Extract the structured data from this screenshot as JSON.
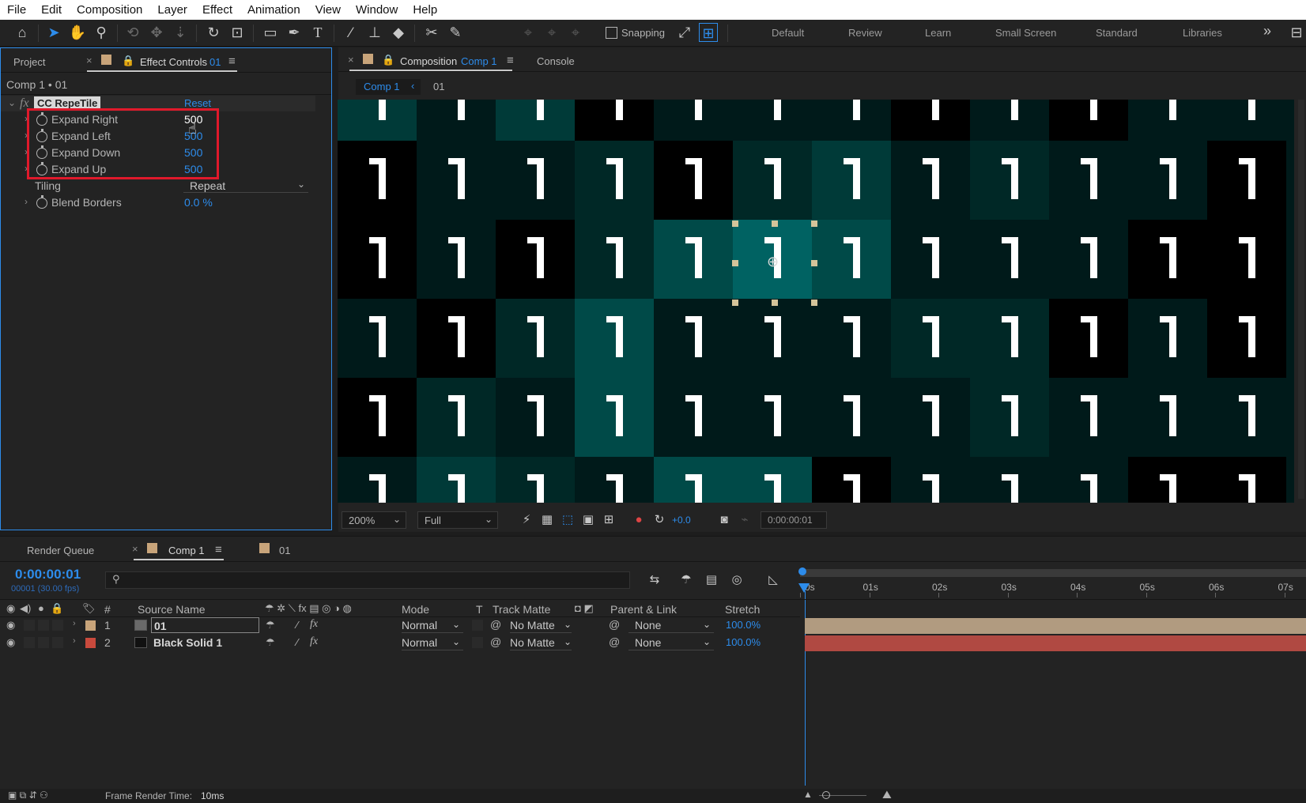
{
  "menu": [
    "File",
    "Edit",
    "Composition",
    "Layer",
    "Effect",
    "Animation",
    "View",
    "Window",
    "Help"
  ],
  "toolbar": {
    "snapping_label": "Snapping",
    "workspaces": [
      "Default",
      "Review",
      "Learn",
      "Small Screen",
      "Standard",
      "Libraries"
    ],
    "more": "»"
  },
  "left_panel": {
    "tab_project": "Project",
    "tab_effect_controls": "Effect Controls",
    "tab_effect_target": "01",
    "breadcrumb": "Comp 1 • 01",
    "effect_name": "CC RepeTile",
    "reset_label": "Reset",
    "fx_label": "fx",
    "properties": [
      {
        "label": "Expand Right",
        "value": "500"
      },
      {
        "label": "Expand Left",
        "value": "500"
      },
      {
        "label": "Expand Down",
        "value": "500"
      },
      {
        "label": "Expand Up",
        "value": "500"
      }
    ],
    "tiling_label": "Tiling",
    "tiling_value": "Repeat",
    "blend_label": "Blend Borders",
    "blend_value": "0.0 %"
  },
  "comp_panel": {
    "tab_label": "Composition",
    "tab_comp": "Comp 1",
    "tab_console": "Console",
    "crumb_comp": "Comp 1",
    "crumb_layer": "01",
    "zoom": "200%",
    "resolution": "Full",
    "exposure": "+0.0",
    "timecode": "0:00:00:01"
  },
  "timeline": {
    "tab_render_queue": "Render Queue",
    "tab_comp": "Comp 1",
    "tab_01": "01",
    "current_time": "0:00:00:01",
    "frame_info": "00001 (30.00 fps)",
    "search_placeholder": "",
    "columns": {
      "num": "#",
      "source": "Source Name",
      "mode": "Mode",
      "t": "T",
      "track_matte": "Track Matte",
      "parent": "Parent & Link",
      "stretch": "Stretch"
    },
    "ruler": [
      "0s",
      "01s",
      "02s",
      "03s",
      "04s",
      "05s",
      "06s",
      "07s"
    ],
    "layers": [
      {
        "num": "1",
        "name": "01",
        "mode": "Normal",
        "matte": "No Matte",
        "parent": "None",
        "stretch": "100.0%",
        "label_color": "#c8a47a",
        "bar_color": "#b19b80"
      },
      {
        "num": "2",
        "name": "Black Solid 1",
        "mode": "Normal",
        "matte": "No Matte",
        "parent": "None",
        "stretch": "100.0%",
        "label_color": "#c94a3d",
        "bar_color": "#b04942"
      }
    ]
  },
  "status": {
    "frame_render_label": "Frame Render Time:",
    "frame_render_value": "10ms"
  },
  "viewer_tiles": [
    [
      "#003a38",
      "#001a1a",
      "#003a38",
      "#000000",
      "#001a1a",
      "#001a1a",
      "#001a1a",
      "#000000",
      "#001a1a",
      "#000000",
      "#001a1a",
      "#001a1a",
      "#001a1a"
    ],
    [
      "#000000",
      "#001a1a",
      "#001a1a",
      "#002826",
      "#000000",
      "#002826",
      "#003a38",
      "#001a1a",
      "#002826",
      "#001a1a",
      "#001a1a",
      "#000000",
      "#001a1a"
    ],
    [
      "#000000",
      "#001a1a",
      "#000000",
      "#002826",
      "#004a48",
      "#006262",
      "#004a48",
      "#001a1a",
      "#001a1a",
      "#001a1a",
      "#000000",
      "#000000",
      "#001a1a"
    ],
    [
      "#001a1a",
      "#000000",
      "#002826",
      "#004a48",
      "#001a1a",
      "#001a1a",
      "#001a1a",
      "#002826",
      "#002826",
      "#000000",
      "#001a1a",
      "#000000",
      "#001a1a"
    ],
    [
      "#000000",
      "#002826",
      "#001a1a",
      "#004a48",
      "#001a1a",
      "#001a1a",
      "#001a1a",
      "#001a1a",
      "#002826",
      "#001a1a",
      "#001a1a",
      "#001a1a",
      "#001a1a"
    ],
    [
      "#001a1a",
      "#003a38",
      "#002826",
      "#001a1a",
      "#004a48",
      "#004a48",
      "#000000",
      "#001a1a",
      "#001a1a",
      "#001a1a",
      "#000000",
      "#000000",
      "#001a1a"
    ]
  ]
}
